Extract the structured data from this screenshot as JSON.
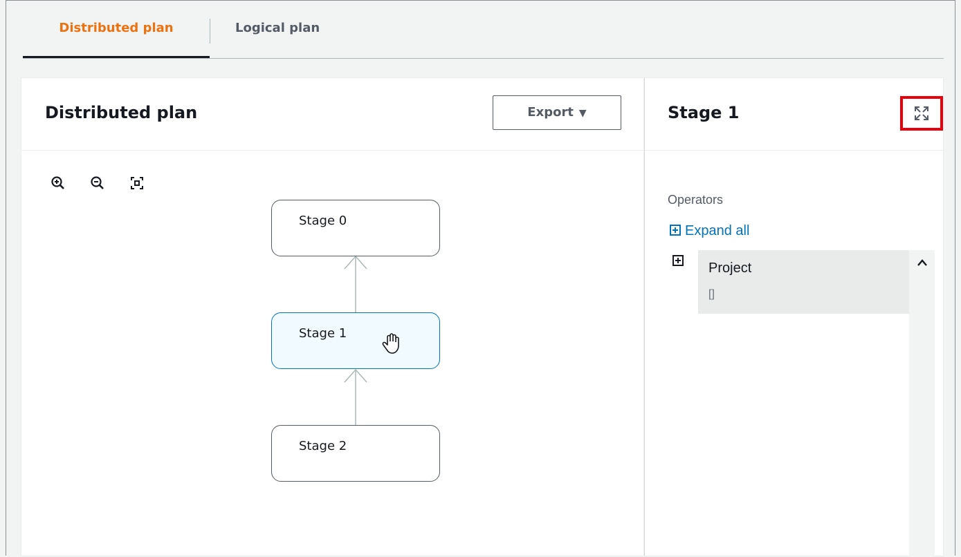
{
  "tabs": [
    {
      "label": "Distributed plan",
      "active": true
    },
    {
      "label": "Logical plan",
      "active": false
    }
  ],
  "plan_panel": {
    "title": "Distributed plan",
    "export_label": "Export",
    "export_caret": "▼",
    "zoom_tools": [
      "zoom-in-icon",
      "zoom-out-icon",
      "fit-to-screen-icon"
    ],
    "stages": [
      {
        "label": "Stage 0",
        "selected": false
      },
      {
        "label": "Stage 1",
        "selected": true
      },
      {
        "label": "Stage 2",
        "selected": false
      }
    ]
  },
  "detail_panel": {
    "title": "Stage 1",
    "operators_label": "Operators",
    "expand_all_label": "Expand all",
    "operators": [
      {
        "name": "Project",
        "args": "[]"
      }
    ]
  },
  "colors": {
    "active_tab": "#ec7211",
    "link": "#0073bb",
    "selected_node_bg": "#f1faff",
    "highlight": "#e8000b"
  }
}
